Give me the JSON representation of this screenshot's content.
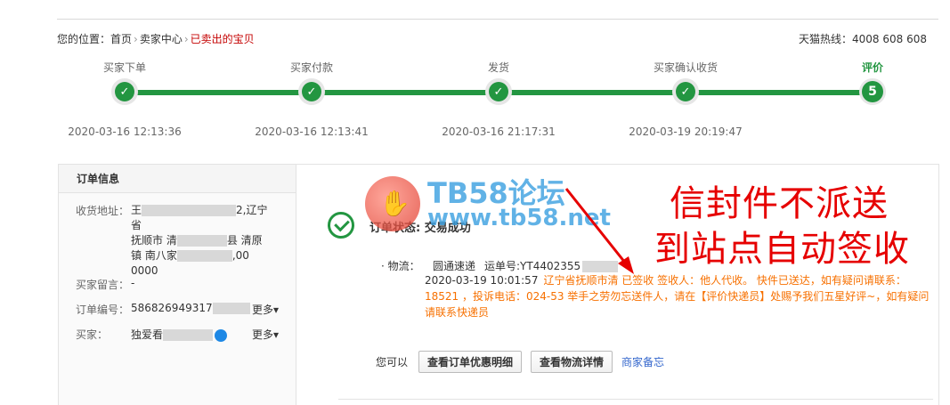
{
  "breadcrumb": {
    "prefix": "您的位置：",
    "home": "首页",
    "seller_center": "卖家中心",
    "current": "已卖出的宝贝",
    "separator": "›"
  },
  "hotline": "天猫热线：4008 608 608",
  "steps": [
    {
      "label": "买家下单",
      "time": "2020-03-16 12:13:36",
      "mark": "✓"
    },
    {
      "label": "买家付款",
      "time": "2020-03-16 12:13:41",
      "mark": "✓"
    },
    {
      "label": "发货",
      "time": "2020-03-16 21:17:31",
      "mark": "✓"
    },
    {
      "label": "买家确认收货",
      "time": "2020-03-19 20:19:47",
      "mark": "✓"
    },
    {
      "label": "评价",
      "time": "",
      "mark": "5"
    }
  ],
  "order_info": {
    "title": "订单信息",
    "address_label": "收货地址：",
    "address_line1": "王",
    "address_line1b": "2,辽宁省",
    "address_line2": "抚顺市 清",
    "address_line2b": "县 清原",
    "address_line3": "镇 南八家",
    "address_line3b": ",00",
    "address_line4": "0000",
    "message_label": "买家留言：",
    "message_value": "-",
    "order_no_label": "订单编号：",
    "order_no_value": "586826949317",
    "buyer_label": "买家：",
    "buyer_value": "独爱看",
    "more": "更多▾"
  },
  "status": {
    "text": "订单状态: 交易成功"
  },
  "logistics": {
    "label": "· 物流：",
    "company": "圆通速递",
    "tracking": "运单号:YT4402355",
    "time": "2020-03-19 10:01:57",
    "detail": "辽宁省抚顺市清                  已签收 签收人：他人代收。 快件已送达，如有疑问请联系：18521              ，投诉电话：024-53                举手之劳勿忘送件人，请在【评价快递员】处赐予我们五星好评~，如有疑问请联系快递员"
  },
  "actions": {
    "hint": "您可以",
    "btn_discount": "查看订单优惠明细",
    "btn_logistics": "查看物流详情",
    "seller_note": "商家备忘"
  },
  "watermark": {
    "title": "TB58论坛",
    "url": "www.tb58.net"
  },
  "annotation": {
    "line1": "信封件不派送",
    "line2": "到站点自动签收"
  },
  "colors": {
    "accent_green": "#239641",
    "link_red": "#c40000",
    "logistics_orange": "#f77000",
    "annotation_red": "#e60000"
  }
}
